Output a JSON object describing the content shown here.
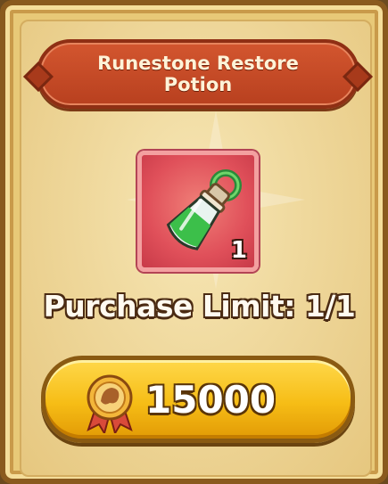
{
  "item": {
    "name": "Runestone Restore Potion",
    "quantity": "1",
    "icon": "green-potion-icon"
  },
  "purchase_limit": "Purchase Limit: 1/1",
  "buy_button": {
    "price": "15000",
    "currency_icon": "medal-coin-icon"
  },
  "colors": {
    "banner": "#c84a25",
    "button": "#f6bd16",
    "slot": "#e0505a"
  }
}
